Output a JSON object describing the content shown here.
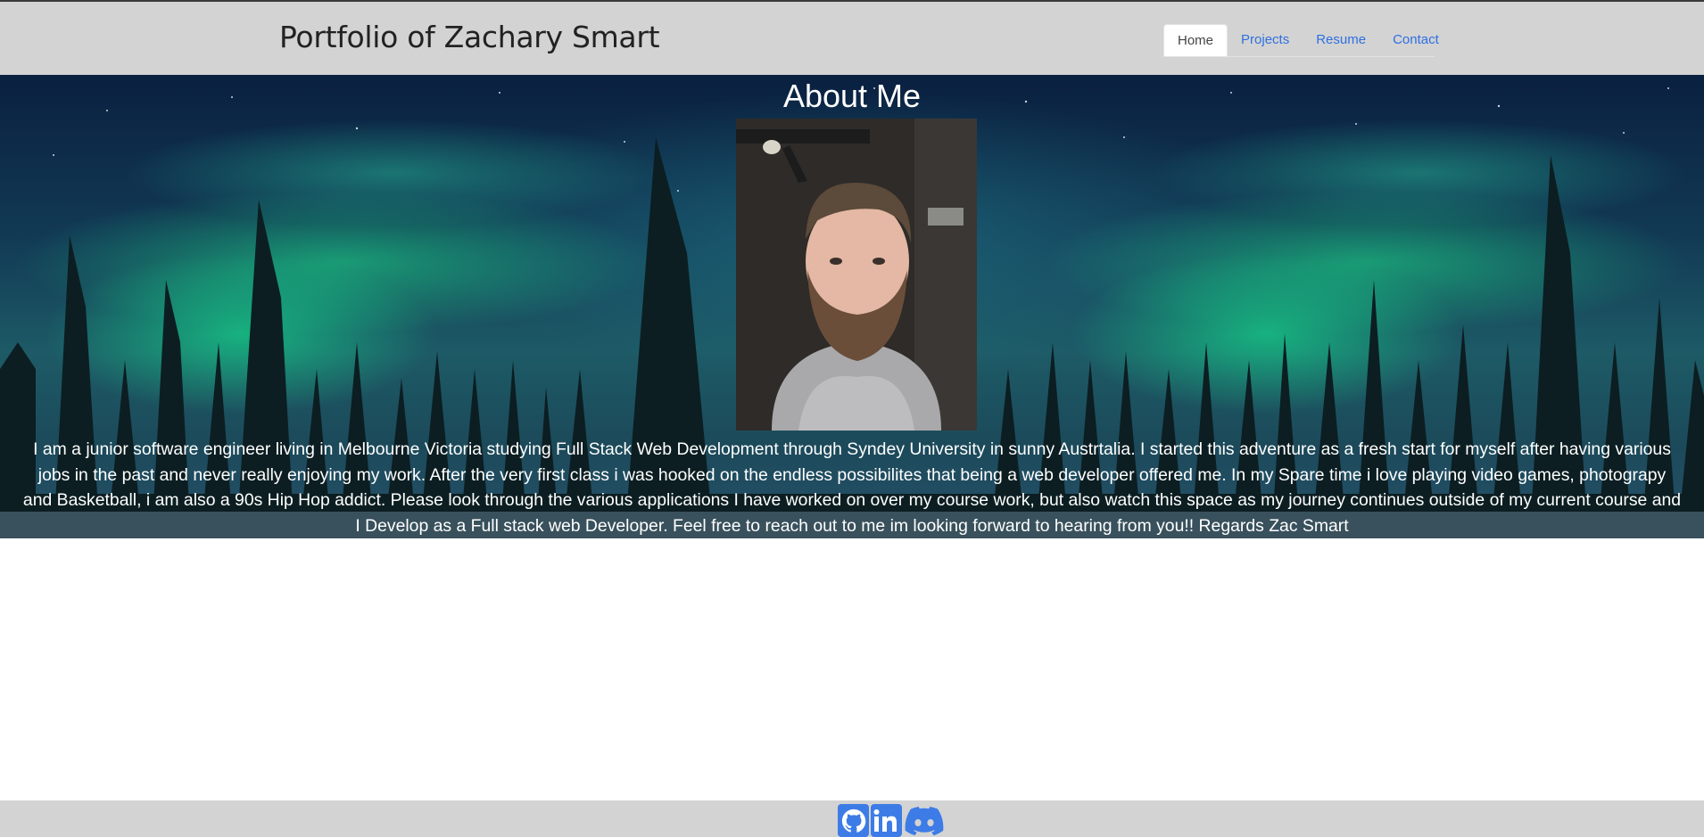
{
  "header": {
    "title": "Portfolio of Zachary Smart",
    "nav": [
      {
        "label": "Home",
        "active": true
      },
      {
        "label": "Projects",
        "active": false
      },
      {
        "label": "Resume",
        "active": false
      },
      {
        "label": "Contact",
        "active": false
      }
    ]
  },
  "about": {
    "heading": "About Me",
    "photo_alt": "Zachary Smart",
    "lines": [
      "I am a junior software engineer living in Melbourne Victoria studying Full Stack Web Development through Syndey University in sunny Austrtalia. I started this adventure as a fresh start for myself after having various",
      "jobs in the past and never really enjoying my work. After the very first class i was hooked on the endless possibilites that being a web developer offered me. In my Spare time i love playing video games, photograpy",
      "and Basketball, i am also a 90s Hip Hop addict. Please look through the various applications I have worked on over my course work, but also watch this space as my journey continues outside of my current course and",
      "I Develop as a Full stack web Developer. Feel free to reach out to me im looking forward to hearing from you!! Regards Zac Smart"
    ]
  },
  "footer": {
    "social": [
      {
        "icon": "github-icon"
      },
      {
        "icon": "linkedin-icon"
      },
      {
        "icon": "discord-icon"
      }
    ]
  },
  "colors": {
    "header_bg": "#d3d3d3",
    "footer_bg": "#d3d3d3",
    "nav_link": "#2f6fe0",
    "social_blue": "#3d7ce6"
  }
}
